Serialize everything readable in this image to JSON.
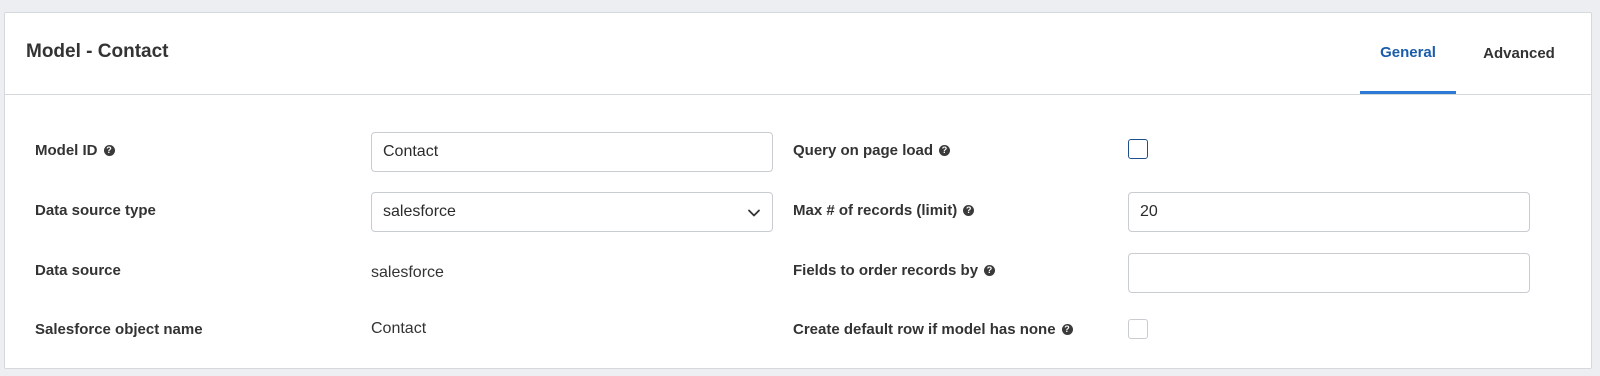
{
  "header": {
    "title": "Model - Contact",
    "tabs": [
      {
        "label": "General",
        "active": true
      },
      {
        "label": "Advanced",
        "active": false
      }
    ]
  },
  "left_fields": {
    "model_id": {
      "label": "Model ID",
      "value": "Contact"
    },
    "data_source_type": {
      "label": "Data source type",
      "value": "salesforce"
    },
    "data_source": {
      "label": "Data source",
      "value": "salesforce"
    },
    "salesforce_object_name": {
      "label": "Salesforce object name",
      "value": "Contact"
    }
  },
  "right_fields": {
    "query_on_page_load": {
      "label": "Query on page load",
      "checked": false
    },
    "max_records": {
      "label": "Max # of records (limit)",
      "value": "20"
    },
    "order_fields": {
      "label": "Fields to order records by",
      "value": ""
    },
    "create_default_row": {
      "label": "Create default row if model has none",
      "checked": false
    }
  },
  "icons": {
    "help": "question-circle-icon",
    "dropdown": "chevron-down-icon"
  },
  "colors": {
    "accent": "#1a5dab",
    "tab_underline": "#2d7ad6",
    "checkbox_border": "#1f4f8a"
  }
}
